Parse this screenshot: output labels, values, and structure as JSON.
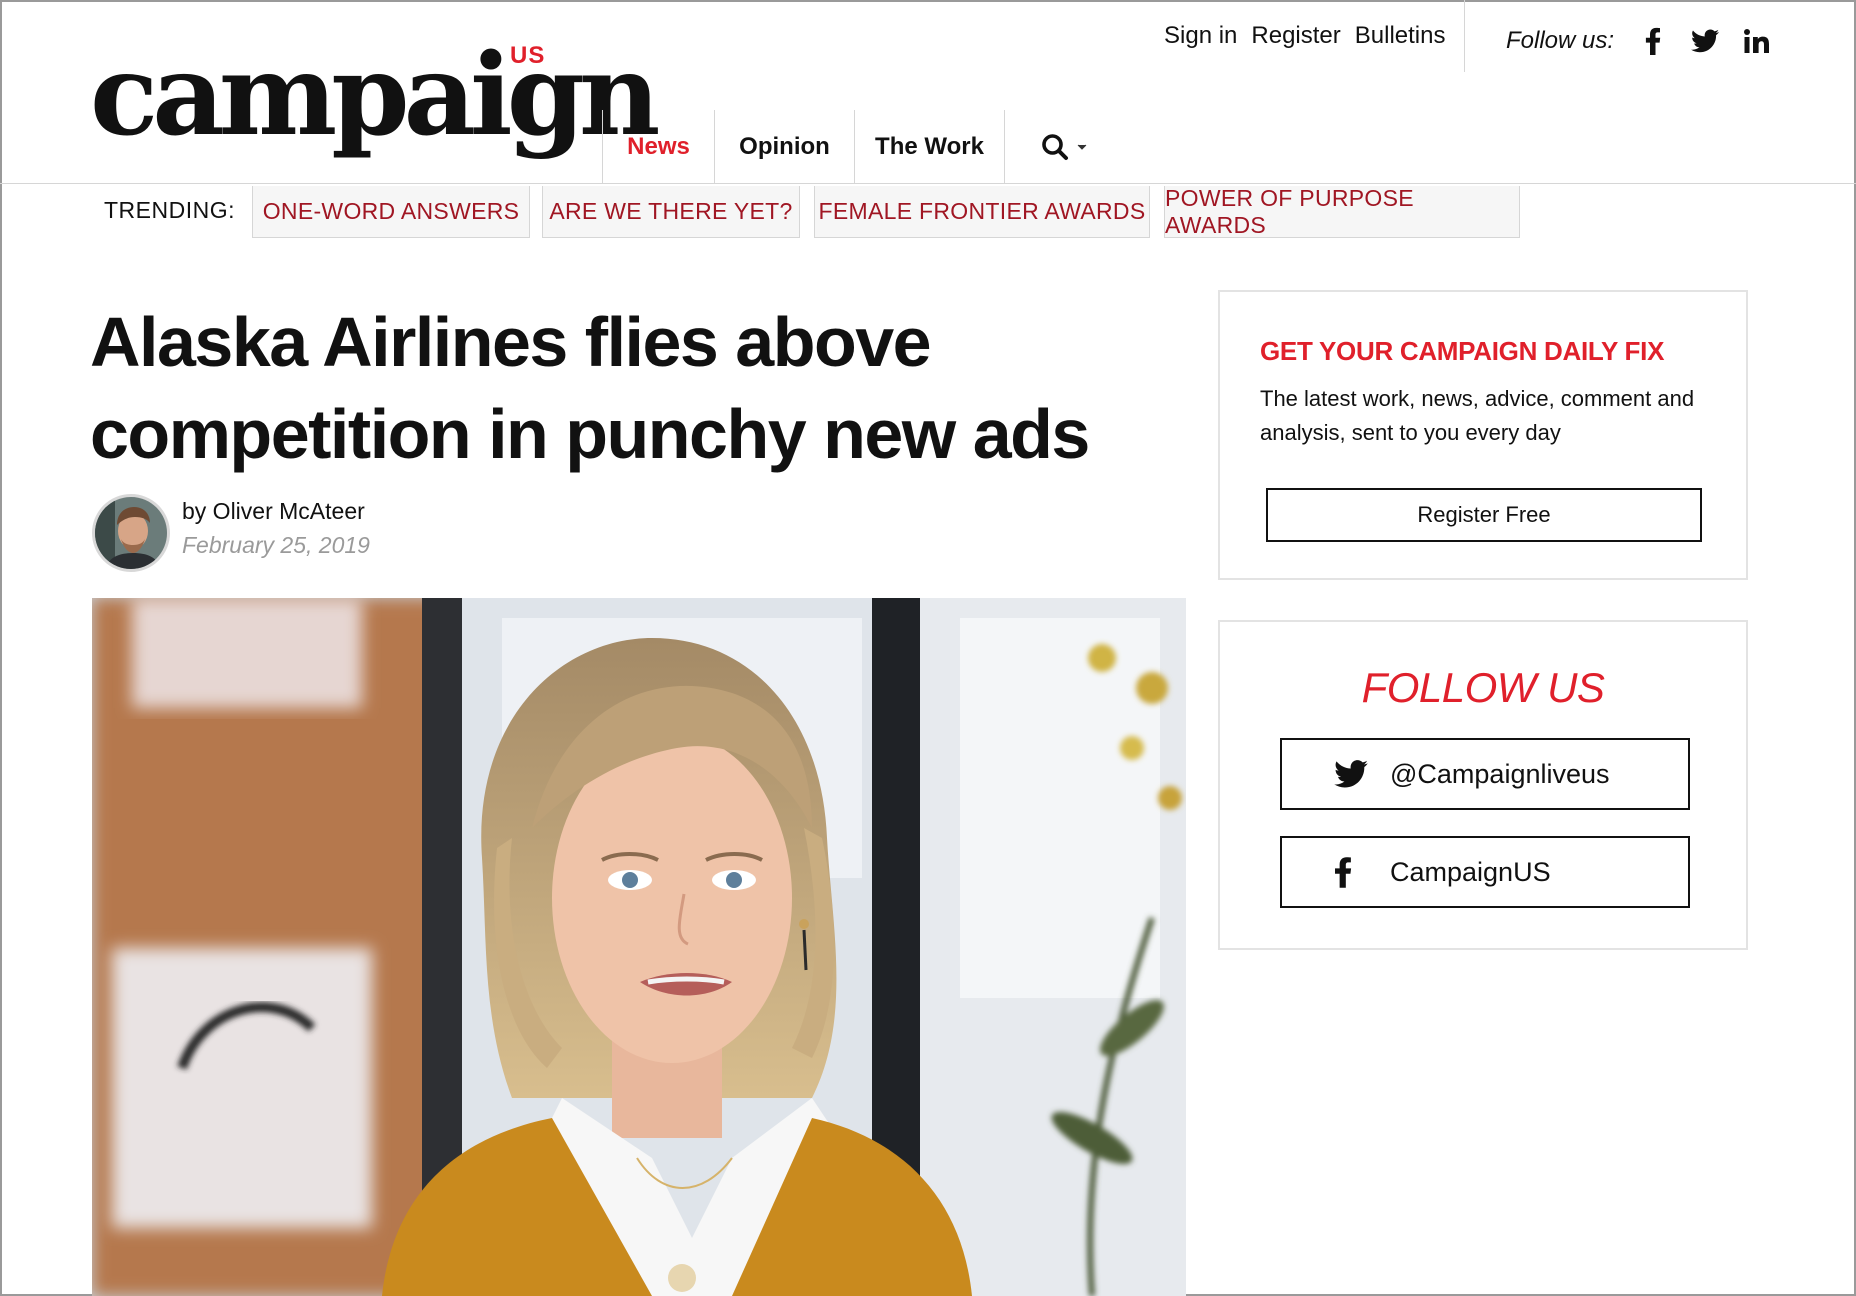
{
  "site": {
    "logo_word": "campaign",
    "logo_edition": "US"
  },
  "utility_nav": {
    "sign_in": "Sign in",
    "register": "Register",
    "bulletins": "Bulletins"
  },
  "follow_bar": {
    "label": "Follow us:",
    "icons": [
      "facebook-icon",
      "twitter-icon",
      "linkedin-icon"
    ]
  },
  "main_nav": {
    "items": [
      {
        "label": "News",
        "active": true
      },
      {
        "label": "Opinion",
        "active": false
      },
      {
        "label": "The Work",
        "active": false
      }
    ],
    "search_icon": "search-icon"
  },
  "trending": {
    "label": "TRENDING:",
    "items": [
      "ONE-WORD ANSWERS",
      "ARE WE THERE YET?",
      "FEMALE FRONTIER AWARDS",
      "POWER OF PURPOSE AWARDS"
    ]
  },
  "article": {
    "headline_line1": "Alaska Airlines flies above",
    "headline_line2": "competition in punchy new ads",
    "byline": "by Oliver McAteer",
    "date": "February 25, 2019"
  },
  "sidebar": {
    "daily_fix": {
      "title": "GET YOUR CAMPAIGN DAILY FIX",
      "text": "The latest work, news, advice, comment and analysis, sent to you every day",
      "button": "Register Free"
    },
    "follow": {
      "title": "FOLLOW US",
      "twitter": "@Campaignliveus",
      "facebook": "CampaignUS"
    }
  },
  "colors": {
    "accent_red": "#e0202b",
    "trending_red": "#a01623",
    "border_gray": "#d6d6d6"
  }
}
